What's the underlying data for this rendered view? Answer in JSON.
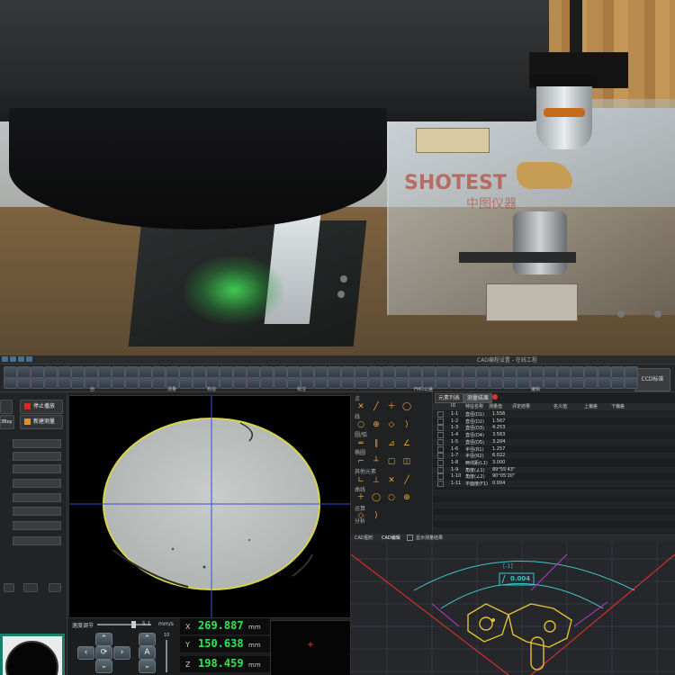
{
  "photo": {
    "watermark_logo": "SHOTEST",
    "watermark_sub": "中图仪器"
  },
  "app": {
    "title": "CAD编程设置 - 在线工程"
  },
  "toolbar": {
    "group_labels": [
      "设",
      "自",
      "测量",
      "构造",
      "标注",
      "FMO公差",
      "编辑"
    ],
    "right_button": "CCD标准"
  },
  "left_panel": {
    "stop_button": "停止播放",
    "new_button": "新建测量",
    "side_label": "3Boy"
  },
  "camera": {
    "speed_label": "速度调节",
    "speed_value": "5.1",
    "speed_unit": "mm/s",
    "slider_top_value": "10"
  },
  "coordinates": [
    {
      "axis": "X",
      "value": "269.887",
      "unit": "mm"
    },
    {
      "axis": "Y",
      "value": "150.638",
      "unit": "mm"
    },
    {
      "axis": "Z",
      "value": "198.459",
      "unit": "mm"
    }
  ],
  "palette": {
    "sections": [
      "点",
      "线",
      "圆/弧",
      "椭圆",
      "其他元素",
      "曲线",
      "运算",
      "分析"
    ]
  },
  "results": {
    "tabs": [
      "元素列表",
      "测量结果"
    ],
    "columns": [
      "ID",
      "特征名称",
      "测量值",
      "评定结果",
      "名义值",
      "上偏差",
      "下偏差"
    ],
    "rows": [
      {
        "id": "1-1",
        "name": "直径(D1)",
        "value": "1.556"
      },
      {
        "id": "1-2",
        "name": "直径(D2)",
        "value": "1.567"
      },
      {
        "id": "1-3",
        "name": "直径(D3)",
        "value": "4.253"
      },
      {
        "id": "1-4",
        "name": "直径(D4)",
        "value": "3.563"
      },
      {
        "id": "1-5",
        "name": "直径(D5)",
        "value": "3.204"
      },
      {
        "id": "1-6",
        "name": "半径(R1)",
        "value": "1.257"
      },
      {
        "id": "1-7",
        "name": "半径(R2)",
        "value": "6.022"
      },
      {
        "id": "1-8",
        "name": "两线距(L1)",
        "value": "3.000"
      },
      {
        "id": "1-9",
        "name": "角度(∠1)",
        "value": "89°55'43\""
      },
      {
        "id": "1-10",
        "name": "角度(∠2)",
        "value": "90°05'20\""
      },
      {
        "id": "1-11",
        "name": "平面度(F1)",
        "value": "0.004"
      }
    ]
  },
  "cad": {
    "tabs": [
      "CAD图形",
      "CAD编辑",
      "显示测量结果"
    ],
    "flatness_label": "[-1]",
    "flatness_value": "0.004"
  }
}
